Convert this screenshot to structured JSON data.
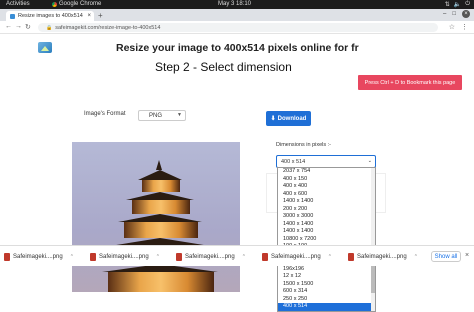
{
  "topbar": {
    "activities": "Activities",
    "app_name": "Google Chrome",
    "clock": "May 3  18:10"
  },
  "browser": {
    "tab_title": "Resize images to 400x514",
    "url": "safeimagekit.com/resize-image-to-400x514"
  },
  "page": {
    "title": "Resize your image to 400x514 pixels online for fr",
    "overlay_title": "Step 2 - Select dimension",
    "toast": "Press Ctrl + D to Bookmark this page",
    "format_label": "Image's Format",
    "format_value": "PNG",
    "download_label": "Download",
    "dimensions_label": "Dimensions in pixels :-",
    "dimensions_value": "400 x 514",
    "dimension_options": [
      "2037 x 754",
      "400 x 150",
      "400 x 400",
      "400 x 600",
      "1400 x 1400",
      "200 x 200",
      "3000 x 3000",
      "1400 x 1400",
      "1400 x 1400",
      "10800 x 7200",
      "100 x 100",
      "840 x 840",
      "840 x 840",
      "196x196",
      "12 x 12",
      "1500 x 1500",
      "600 x 314",
      "250 x 250",
      "400 x 514"
    ],
    "selected_index": 18
  },
  "downloads": {
    "items": [
      "Safeimageki....png",
      "Safeimageki....png",
      "Safeimageki....png",
      "Safeimageki....png",
      "Safeimageki....png"
    ],
    "show_all": "Show all"
  }
}
